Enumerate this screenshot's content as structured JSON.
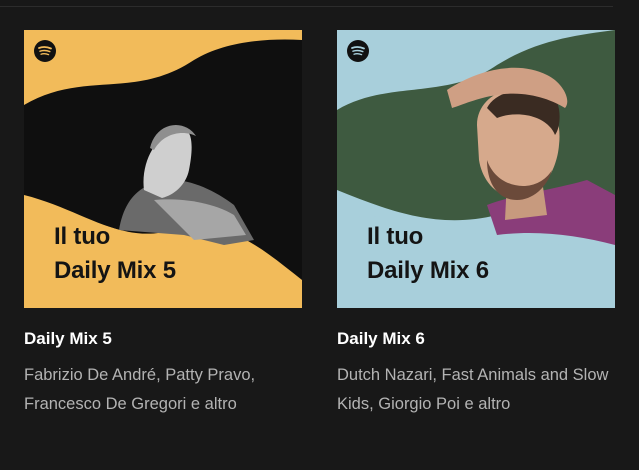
{
  "cards": [
    {
      "cover_line1": "Il tuo",
      "cover_line2": "Daily Mix 5",
      "title": "Daily Mix 5",
      "description": "Fabrizio De André, Patty Pravo, Francesco De Gregori e altro",
      "accent": "#f2bb5a",
      "photo_bg": "#101010"
    },
    {
      "cover_line1": "Il tuo",
      "cover_line2": "Daily Mix 6",
      "title": "Daily Mix 6",
      "description": "Dutch Nazari, Fast Animals and Slow Kids, Giorgio Poi e altro",
      "accent": "#a8cfdb",
      "photo_bg": "#3e5a40"
    }
  ]
}
